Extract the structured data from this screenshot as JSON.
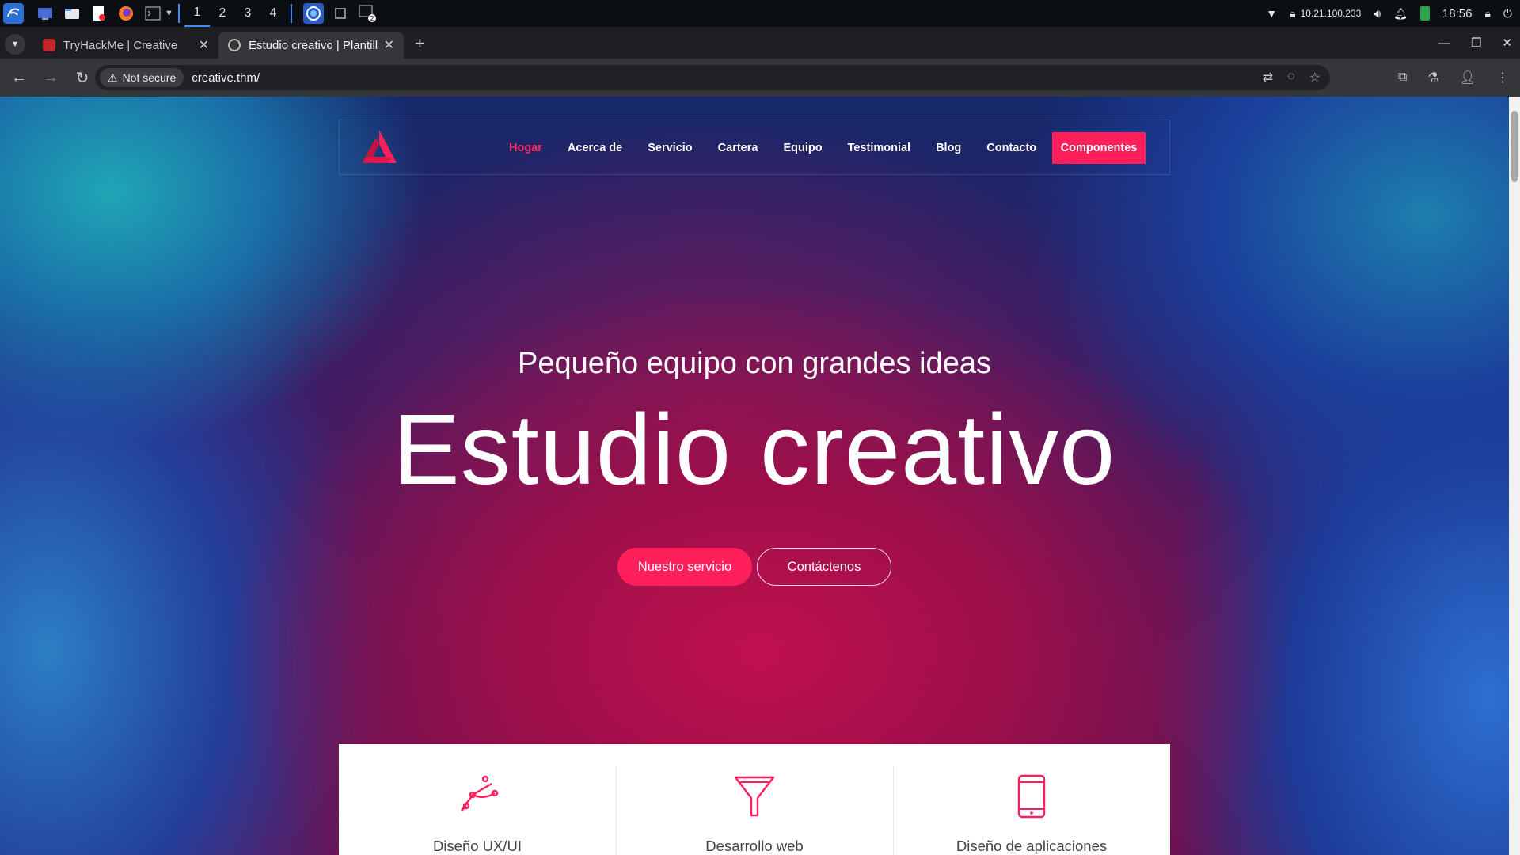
{
  "taskbar": {
    "workspaces": [
      "1",
      "2",
      "3",
      "4"
    ],
    "active_workspace": "1",
    "ip_address": "10.21.100.233",
    "clock": "18:56"
  },
  "browser": {
    "tabs": [
      {
        "title": "TryHackMe | Creative",
        "active": false
      },
      {
        "title": "Estudio creativo | Plantilla",
        "active": true
      }
    ],
    "security_chip": "Not secure",
    "url": "creative.thm/"
  },
  "site": {
    "nav": {
      "items": [
        "Hogar",
        "Acerca de",
        "Servicio",
        "Cartera",
        "Equipo",
        "Testimonial",
        "Blog",
        "Contacto"
      ],
      "active_item": "Hogar",
      "cta": "Componentes"
    },
    "hero": {
      "subtitle": "Pequeño equipo con grandes ideas",
      "title": "Estudio creativo",
      "primary_button": "Nuestro servicio",
      "secondary_button": "Contáctenos"
    },
    "services": [
      {
        "label": "Diseño UX/UI",
        "icon": "vector-pen-icon"
      },
      {
        "label": "Desarrollo web",
        "icon": "funnel-icon"
      },
      {
        "label": "Diseño de aplicaciones",
        "icon": "tablet-icon"
      }
    ],
    "colors": {
      "accent": "#ff1f5a"
    }
  }
}
